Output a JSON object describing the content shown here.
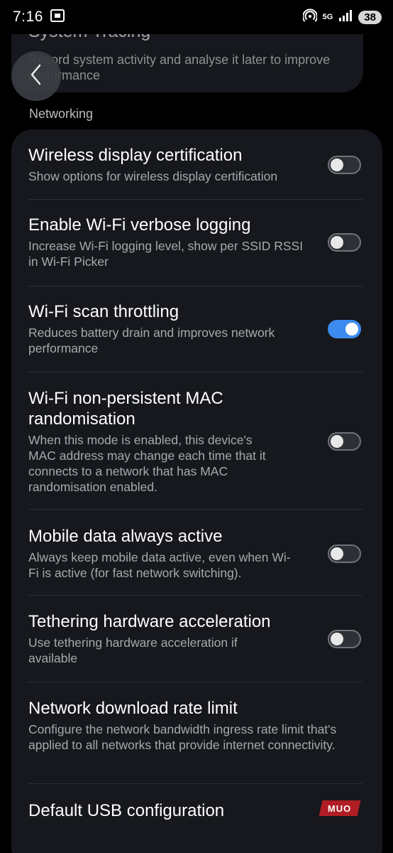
{
  "status_bar": {
    "time": "7:16",
    "network": "5G",
    "battery": "38",
    "icons": [
      "screenshot-icon",
      "hotspot-icon",
      "signal-icon"
    ]
  },
  "previous_item": {
    "title": "System Tracing",
    "description": "Record system activity and analyse it later to improve performance"
  },
  "section": {
    "title": "Networking"
  },
  "settings": [
    {
      "title": "Wireless display certification",
      "description": "Show options for wireless display certification",
      "toggle": "off"
    },
    {
      "title": "Enable Wi-Fi verbose logging",
      "description": "Increase Wi-Fi logging level, show per SSID RSSI in Wi-Fi Picker",
      "toggle": "off"
    },
    {
      "title": "Wi-Fi scan throttling",
      "description": "Reduces battery drain and improves network performance",
      "toggle": "on"
    },
    {
      "title": "Wi-Fi non-persistent MAC randomisation",
      "description": "When this mode is enabled, this device's MAC address may change each time that it connects to a network that has MAC randomisation enabled.",
      "toggle": "off"
    },
    {
      "title": "Mobile data always active",
      "description": "Always keep mobile data active, even when Wi-Fi is active (for fast network switching).",
      "toggle": "off"
    },
    {
      "title": "Tethering hardware acceleration",
      "description": "Use tethering hardware acceleration if available",
      "toggle": "off"
    },
    {
      "title": "Network download rate limit",
      "description": "Configure the network bandwidth ingress rate limit that's applied to all networks that provide internet connectivity.",
      "toggle": null
    },
    {
      "title": "Default USB configuration",
      "description": "",
      "toggle": null
    }
  ],
  "watermark": "MUO",
  "colors": {
    "background": "#000000",
    "card": "#16181d",
    "accent": "#3d8bef",
    "secondary_text": "#a6a9ad"
  }
}
